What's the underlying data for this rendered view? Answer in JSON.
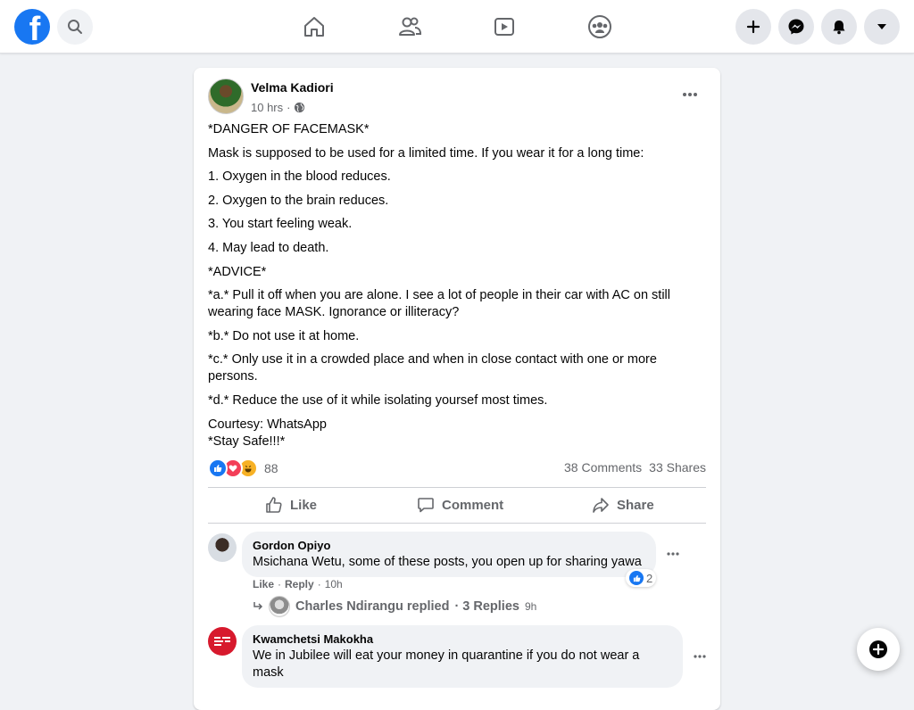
{
  "nav": {
    "logo_letter": "f",
    "brand_color": "#1877f2"
  },
  "post": {
    "author": "Velma Kadiori",
    "time": "10 hrs",
    "separator": "·",
    "paragraphs": [
      "*DANGER OF FACEMASK*",
      "Mask is supposed to be used for a limited time. If you wear it for a long time:",
      "1. Oxygen in the blood reduces.",
      "2. Oxygen to the brain reduces.",
      "3. You start feeling weak.",
      "4. May lead to death.",
      "*ADVICE*",
      "*a.* Pull it off when you are alone. I see a lot of people in their car with AC on still wearing face MASK. Ignorance or illiteracy?",
      "*b.* Do not use it at home.",
      "*c.* Only use it in a crowded place and when in close contact with one or more persons.",
      "*d.* Reduce the use of it while isolating yoursef most times.",
      "Courtesy: WhatsApp\n *Stay Safe!!!*"
    ],
    "reaction_count": "88",
    "comments_count": "38 Comments",
    "shares_count": "33 Shares",
    "like_label": "Like",
    "comment_label": "Comment",
    "share_label": "Share"
  },
  "comments": [
    {
      "name": "Gordon Opiyo",
      "text": "Msichana Wetu, some of these posts, you open up for sharing yawa",
      "like": "Like",
      "reply": "Reply",
      "time": "10h",
      "likes": "2",
      "replies": {
        "who": "Charles Ndirangu replied",
        "count": "· 3 Replies",
        "time": "9h"
      }
    },
    {
      "name": "Kwamchetsi Makokha",
      "text": "We in Jubilee will eat your money in quarantine if you do not wear a mask"
    }
  ]
}
